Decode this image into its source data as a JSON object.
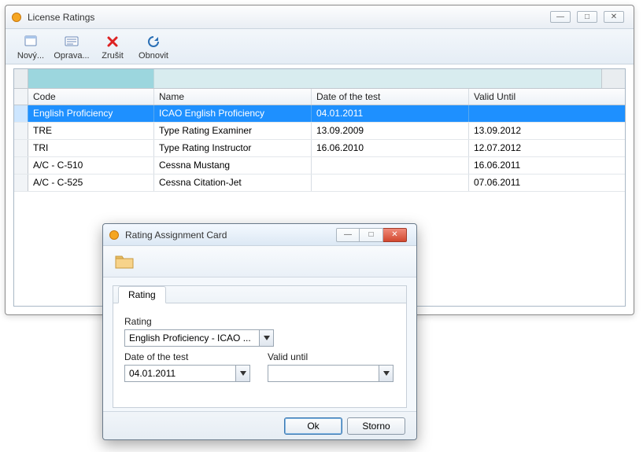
{
  "main": {
    "title": "License Ratings",
    "win_controls": {
      "min": "—",
      "max": "□",
      "close": "✕"
    },
    "toolbar": [
      {
        "icon": "new-file-icon",
        "label": "Nový..."
      },
      {
        "icon": "edit-icon",
        "label": "Oprava..."
      },
      {
        "icon": "cancel-icon",
        "label": "Zrušit"
      },
      {
        "icon": "refresh-icon",
        "label": "Obnovit"
      }
    ],
    "columns": {
      "code": "Code",
      "name": "Name",
      "date": "Date of the test",
      "valid": "Valid Until"
    },
    "rows": [
      {
        "code": "English Proficiency",
        "name": "ICAO English Proficiency",
        "date": "04.01.2011",
        "valid": ""
      },
      {
        "code": "TRE",
        "name": "Type Rating Examiner",
        "date": "13.09.2009",
        "valid": "13.09.2012"
      },
      {
        "code": "TRI",
        "name": "Type Rating Instructor",
        "date": "16.06.2010",
        "valid": "12.07.2012"
      },
      {
        "code": "A/C - C-510",
        "name": "Cessna Mustang",
        "date": "",
        "valid": "16.06.2011"
      },
      {
        "code": "A/C - C-525",
        "name": "Cessna Citation-Jet",
        "date": "",
        "valid": "07.06.2011"
      }
    ],
    "selected_index": 0
  },
  "dialog": {
    "title": "Rating Assignment Card",
    "win_controls": {
      "min": "—",
      "max": "□",
      "close": "✕"
    },
    "tab_label": "Rating",
    "rating_label": "Rating",
    "rating_value": "English Proficiency - ICAO ...",
    "date_label": "Date of the test",
    "date_value": "04.01.2011",
    "valid_label": "Valid until",
    "valid_value": "",
    "ok_label": "Ok",
    "cancel_label": "Storno"
  }
}
